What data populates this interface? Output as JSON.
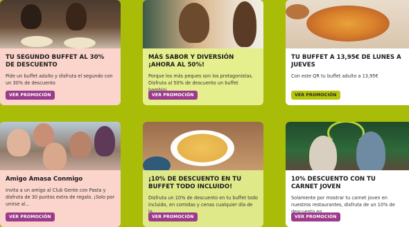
{
  "cards": [
    {
      "title": "TU SEGUNDO BUFFET AL 30% DE DESCUENTO",
      "desc": "Pide un buffet adulto y disfruta el segundo con un 30% de descuento",
      "button": "VER PROMOCIÓN",
      "button_style": "purple",
      "bg": "#fbd5cb"
    },
    {
      "title": "MÁS SABOR Y DIVERSIÓN ¡AHORA AL 50%!",
      "desc": "Porque los más peques son los protagonistas. Disfruta al 50% de descuento un buffet bambini...",
      "button": "VER PROMOCIÓN",
      "button_style": "purple",
      "bg": "#e6ef8e"
    },
    {
      "title": "TU BUFFET A 13,95€ DE LUNES A JUEVES",
      "desc": "Con este QR tu buffet adulto a 13,95€",
      "button": "VER PROMOCIÓN",
      "button_style": "lime",
      "bg": "#ffffff"
    },
    {
      "title": "Amigo Amasa Conmigo",
      "desc": "Invita a un amigo al Club Gente con Pasta y disfruta de 30 puntos extra de regalo. ¡Solo por unirse al...",
      "button": "VER PROMOCIÓN",
      "button_style": "purple",
      "bg": "#fbd5cb"
    },
    {
      "title": "¡10% DE DESCUENTO EN TU BUFFET TODO INCLUIDO!",
      "desc": "Disfruta un 10% de descuento en tu buffet todo incluido, en comidas y cenas cualquier día de la...",
      "button": "VER PROMOCIÓN",
      "button_style": "purple",
      "bg": "#e6ef8e"
    },
    {
      "title": "10% DESCUENTO CON TU CARNET JOVEN",
      "desc": "Solamente por mostrar tu carnet joven en nuestros restaurantes, disfruta de un 10% de descuento en ...",
      "button": "VER PROMOCIÓN",
      "button_style": "purple",
      "bg": "#ffffff"
    }
  ],
  "colors": {
    "page_bg": "#a9bc07",
    "button_purple": "#9c3a8c",
    "button_lime": "#b7c60a"
  }
}
